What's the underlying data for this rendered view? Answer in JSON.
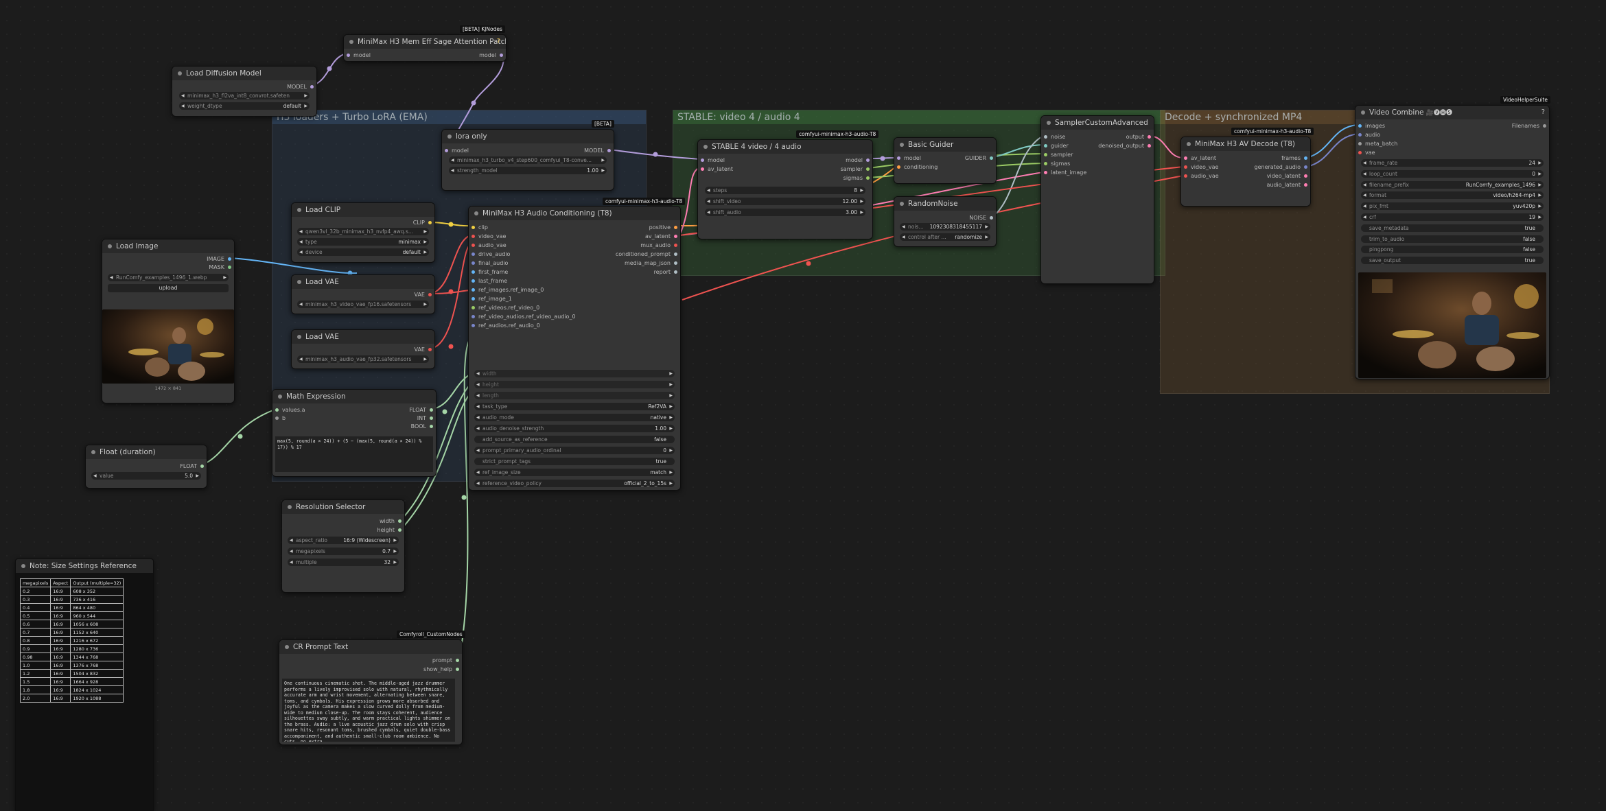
{
  "groups": [
    {
      "id": "loaders",
      "title": "H3 loaders + Turbo LoRA (EMA)",
      "color": "#3b5b82"
    },
    {
      "id": "stable",
      "title": "STABLE: video 4 / audio 4",
      "color": "#3e7a3e"
    },
    {
      "id": "decode",
      "title": "Decode + synchronized MP4",
      "color": "#7a5a32"
    }
  ],
  "node_badges": {
    "kjnodes": "[BETA] KJNodes",
    "beta": "[BETA]",
    "t8_a": "comfyui-minimax-h3-audio-T8",
    "t8_b": "comfyui-minimax-h3-audio-T8",
    "t8_c": "comfyui-minimax-h3-audio-T8",
    "vhs": "VideoHelperSuite",
    "comfyroll": "Comfyroll_CustomNodes"
  },
  "nodes": {
    "sage": {
      "title": "MiniMax H3 Mem Eff Sage Attention Patch",
      "in_model": "model",
      "out_model": "model",
      "help": "?"
    },
    "load_diffusion": {
      "title": "Load Diffusion Model",
      "out": "MODEL",
      "unet_name": "minimax_h3_fl2va_int8_convrot.safeten",
      "weight_dtype_label": "weight_dtype",
      "weight_dtype": "default"
    },
    "lora": {
      "title": "lora only",
      "in_model": "model",
      "out": "MODEL",
      "lora_name": "minimax_h3_turbo_v4_step600_comfyui_T8-conve...",
      "strength_label": "strength_model",
      "strength": "1.00"
    },
    "load_clip": {
      "title": "Load CLIP",
      "out": "CLIP",
      "clip_name": "qwen3vl_32b_minimax_h3_nvfp4_awq.s...",
      "type_label": "type",
      "type": "minimax",
      "device_label": "device",
      "device": "default"
    },
    "load_image": {
      "title": "Load Image",
      "out_image": "IMAGE",
      "out_mask": "MASK",
      "image": "RunComfy_examples_1496_1.webp",
      "upload": "upload",
      "dims": "1472 × 841"
    },
    "load_vae1": {
      "title": "Load VAE",
      "out": "VAE",
      "vae_name": "minimax_h3_video_vae_fp16.safetensors"
    },
    "load_vae2": {
      "title": "Load VAE",
      "out": "VAE",
      "vae_name": "minimax_h3_audio_vae_fp32.safetensors"
    },
    "math": {
      "title": "Math Expression",
      "in_a": "values.a",
      "in_b": "b",
      "out_float": "FLOAT",
      "out_int": "INT",
      "out_bool": "BOOL",
      "expression": "max(5, round(a × 24)) + (5 − (max(5, round(a × 24)) % 17)) % 17"
    },
    "float_duration": {
      "title": "Float (duration)",
      "out": "FLOAT",
      "label": "value",
      "value": "5.0"
    },
    "conditioning": {
      "title": "MiniMax H3 Audio Conditioning (T8)",
      "inputs": [
        "clip",
        "video_vae",
        "audio_vae",
        "drive_audio",
        "final_audio",
        "first_frame",
        "last_frame",
        "ref_images.ref_image_0",
        "ref_image_1",
        "ref_videos.ref_video_0",
        "ref_video_audios.ref_video_audio_0",
        "ref_audios.ref_audio_0"
      ],
      "outputs": [
        "positive",
        "av_latent",
        "mux_audio",
        "conditioned_prompt",
        "media_map_json",
        "report"
      ],
      "dim_inputs": [
        "width",
        "height",
        "length"
      ],
      "widgets": [
        {
          "label": "task_type",
          "value": "Ref2VA"
        },
        {
          "label": "audio_mode",
          "value": "native"
        },
        {
          "label": "audio_denoise_strength",
          "value": "1.00"
        },
        {
          "label": "add_source_as_reference",
          "value": "false"
        },
        {
          "label": "prompt_primary_audio_ordinal",
          "value": "0"
        },
        {
          "label": "strict_prompt_tags",
          "value": "true"
        },
        {
          "label": "ref_image_size",
          "value": "match"
        },
        {
          "label": "reference_video_policy",
          "value": "official_2_to_15s"
        }
      ]
    },
    "stable4": {
      "title": "STABLE 4 video / 4 audio",
      "in_model": "model",
      "in_av": "av_latent",
      "out_model": "model",
      "out_sampler": "sampler",
      "out_sigmas": "sigmas",
      "widgets": [
        {
          "label": "steps",
          "value": "8"
        },
        {
          "label": "shift_video",
          "value": "12.00"
        },
        {
          "label": "shift_audio",
          "value": "3.00"
        }
      ]
    },
    "guider": {
      "title": "Basic Guider",
      "in_model": "model",
      "in_cond": "conditioning",
      "out": "GUIDER"
    },
    "noise": {
      "title": "RandomNoise",
      "out": "NOISE",
      "seed_label": "noise...",
      "seed": "1092308318455117",
      "control_label": "control after ...",
      "control": "randomize"
    },
    "sampler": {
      "title": "SamplerCustomAdvanced",
      "inputs": [
        "noise",
        "guider",
        "sampler",
        "sigmas",
        "latent_image"
      ],
      "outputs": [
        "output",
        "denoised_output"
      ]
    },
    "decode": {
      "title": "MiniMax H3 AV Decode (T8)",
      "inputs": [
        "av_latent",
        "video_vae",
        "audio_vae"
      ],
      "outputs": [
        "frames",
        "generated_audio",
        "video_latent",
        "audio_latent"
      ]
    },
    "combine": {
      "title": "Video Combine",
      "title_suffix": "🎥🅥🅗🅢",
      "inputs": [
        "images",
        "audio",
        "meta_batch",
        "vae"
      ],
      "out": "Filenames",
      "help": "?",
      "widgets": [
        {
          "label": "frame_rate",
          "value": "24"
        },
        {
          "label": "loop_count",
          "value": "0"
        },
        {
          "label": "filename_prefix",
          "value": "RunComfy_examples_1496"
        },
        {
          "label": "format",
          "value": "video/h264-mp4"
        },
        {
          "label": "pix_fmt",
          "value": "yuv420p"
        },
        {
          "label": "crf",
          "value": "19"
        },
        {
          "label": "save_metadata",
          "value": "true"
        },
        {
          "label": "trim_to_audio",
          "value": "false"
        },
        {
          "label": "pingpong",
          "value": "false"
        },
        {
          "label": "save_output",
          "value": "true"
        }
      ]
    },
    "resolution": {
      "title": "Resolution Selector",
      "out_width": "width",
      "out_height": "height",
      "widgets": [
        {
          "label": "aspect_ratio",
          "value": "16:9 (Widescreen)"
        },
        {
          "label": "megapixels",
          "value": "0.7"
        },
        {
          "label": "multiple",
          "value": "32"
        }
      ]
    },
    "prompt": {
      "title": "CR Prompt Text",
      "out_prompt": "prompt",
      "out_help": "show_help",
      "text": "One continuous cinematic shot. The middle-aged jazz drummer performs a lively improvised solo with natural, rhythmically accurate arm and wrist movement, alternating between snare, toms, and cymbals. His expression grows more absorbed and joyful as the camera makes a slow curved dolly from medium-wide to medium close-up. The room stays coherent, audience silhouettes sway subtly, and warm practical lights shimmer on the brass. Audio: a live acoustic jazz drum solo with crisp snare hits, resonant toms, brushed cymbals, quiet double-bass accompaniment, and authentic small-club room ambience. No cuts, no extra"
    },
    "note": {
      "title": "Note: Size Settings Reference",
      "headers": [
        "megapixels",
        "Aspect",
        "Output (multiple=32)"
      ],
      "rows": [
        [
          "0.2",
          "16:9",
          "608 x 352"
        ],
        [
          "0.3",
          "16:9",
          "736 x 416"
        ],
        [
          "0.4",
          "16:9",
          "864 x 480"
        ],
        [
          "0.5",
          "16:9",
          "960 x 544"
        ],
        [
          "0.6",
          "16:9",
          "1056 x 608"
        ],
        [
          "0.7",
          "16:9",
          "1152 x 640"
        ],
        [
          "0.8",
          "16:9",
          "1216 x 672"
        ],
        [
          "0.9",
          "16:9",
          "1280 x 736"
        ],
        [
          "0.98",
          "16:9",
          "1344 x 768"
        ],
        [
          "1.0",
          "16:9",
          "1376 x 768"
        ],
        [
          "1.2",
          "16:9",
          "1504 x 832"
        ],
        [
          "1.5",
          "16:9",
          "1664 x 928"
        ],
        [
          "1.8",
          "16:9",
          "1824 x 1024"
        ],
        [
          "2.0",
          "16:9",
          "1920 x 1088"
        ]
      ]
    }
  }
}
